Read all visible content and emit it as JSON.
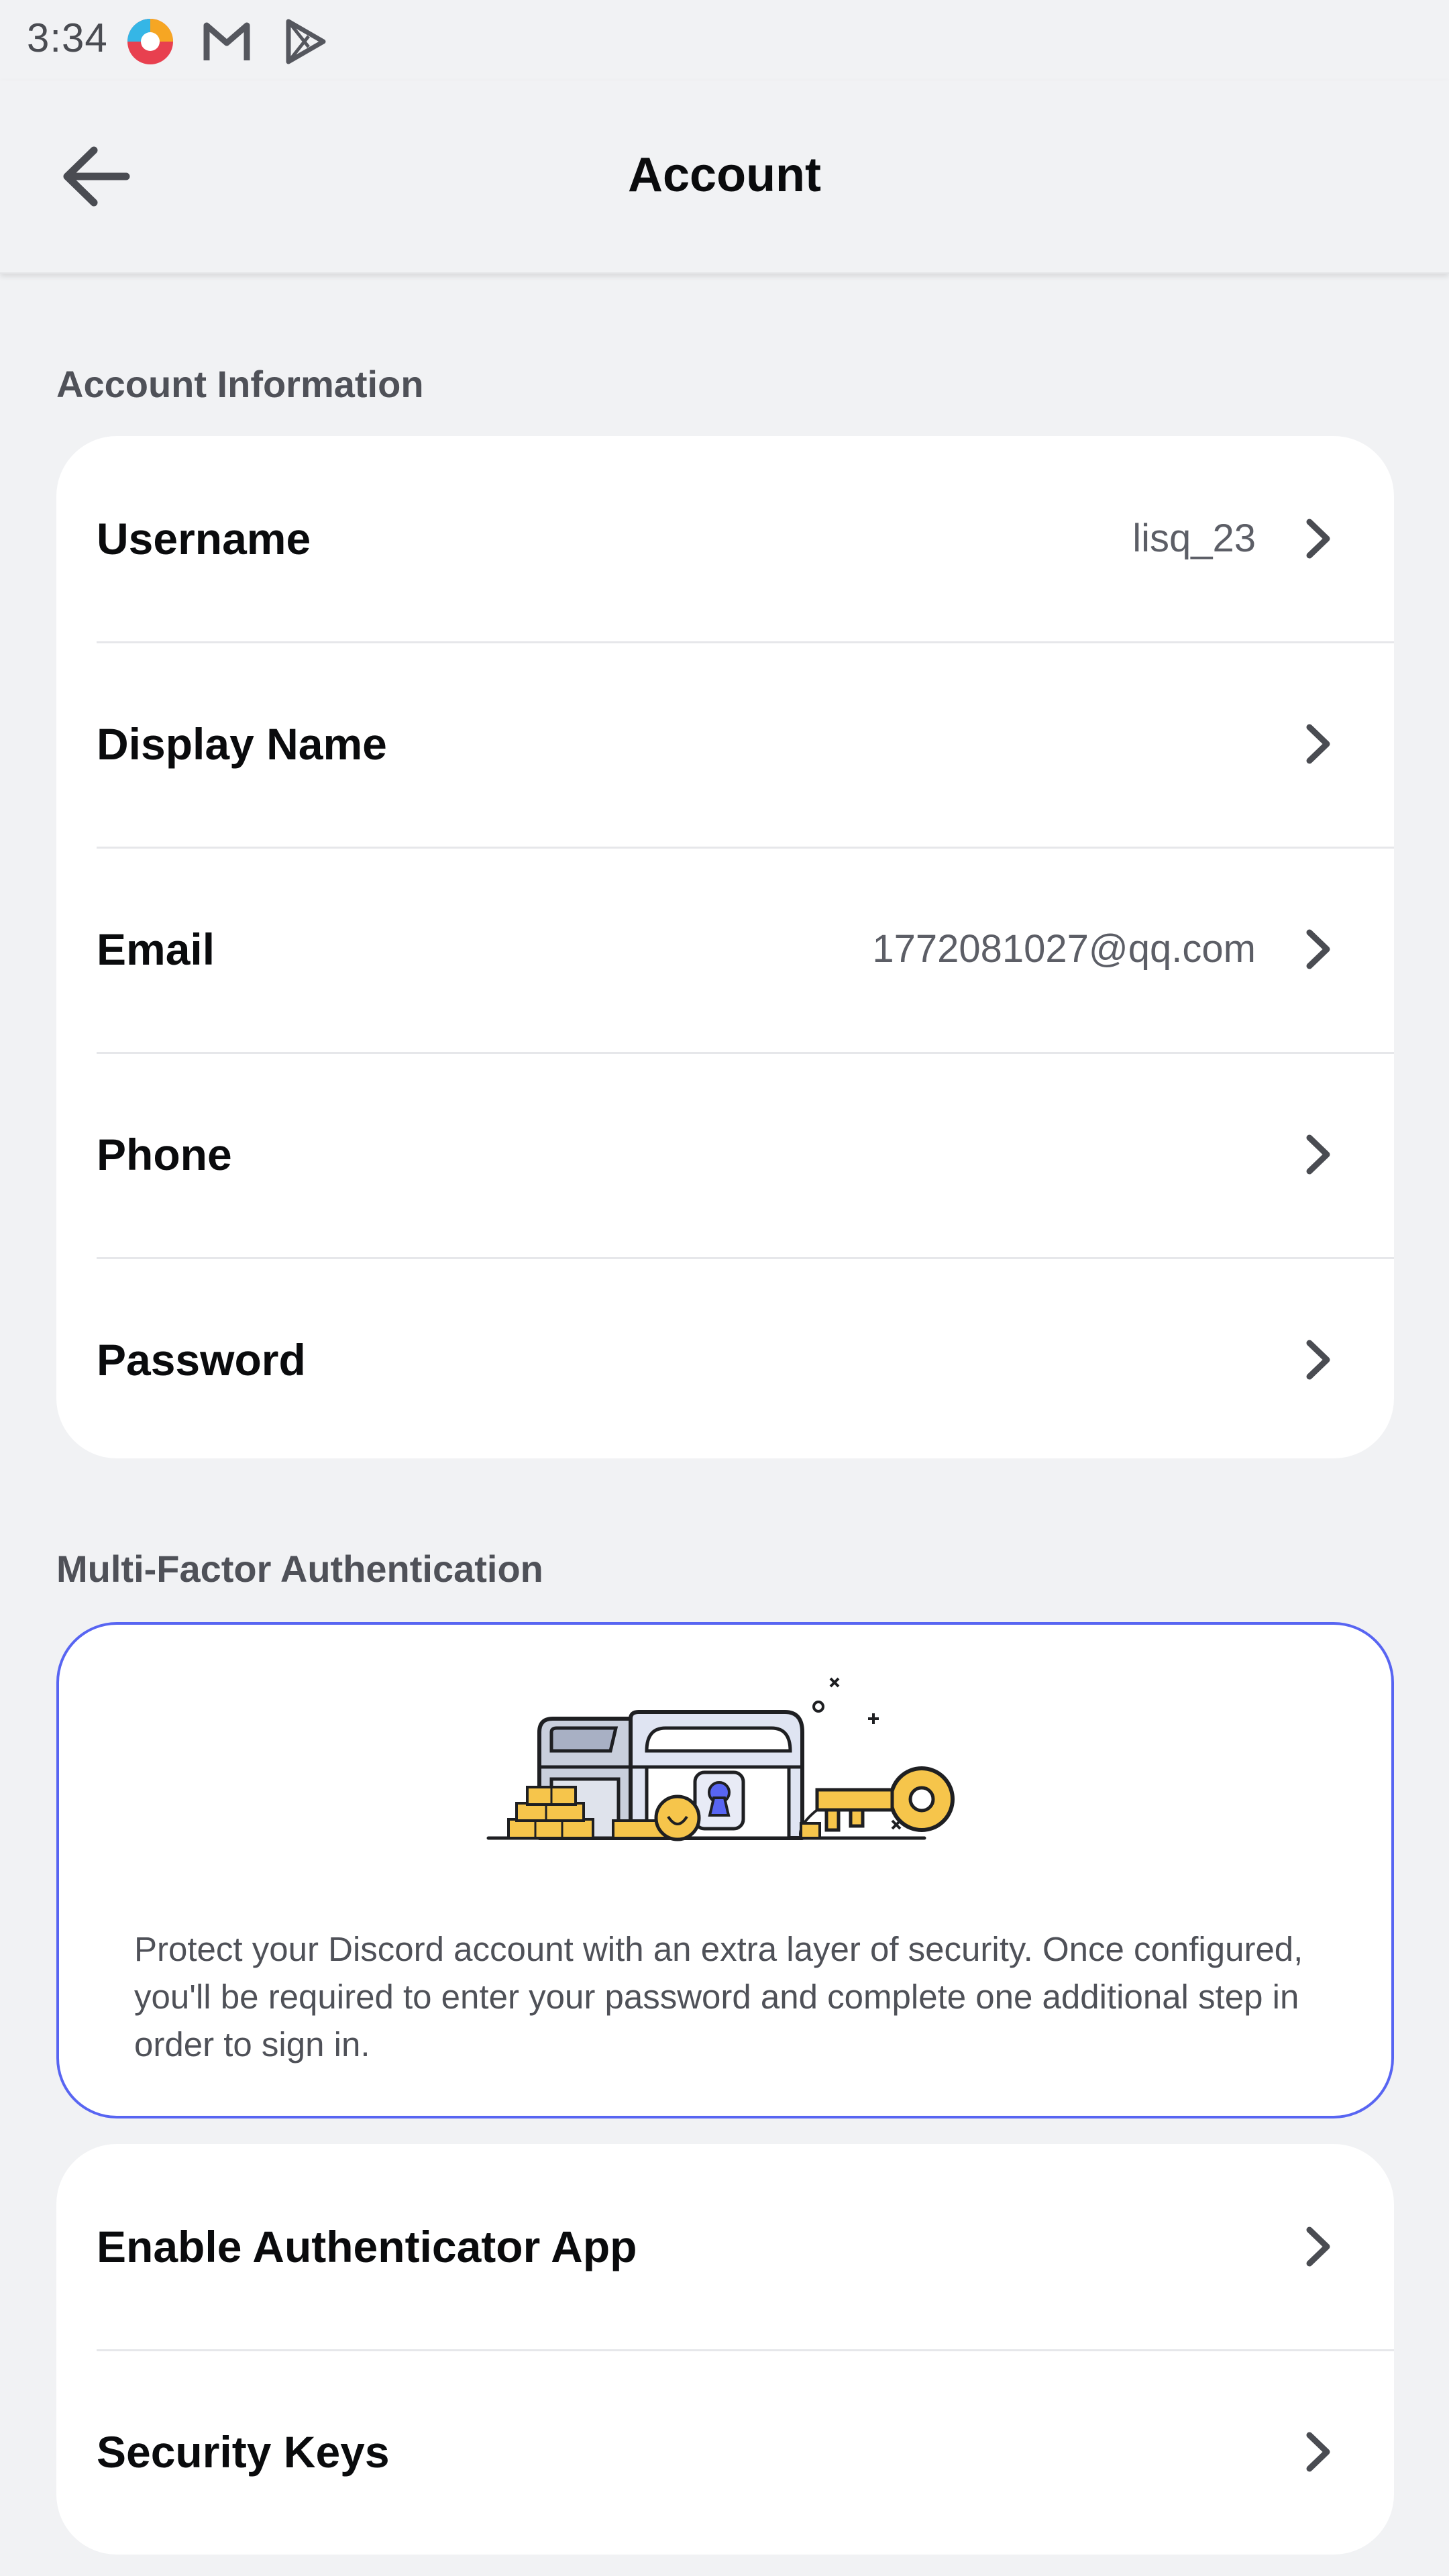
{
  "status_bar": {
    "time": "3:34",
    "icons": [
      "colorful-app-icon",
      "gmail-icon",
      "play-store-icon"
    ]
  },
  "header": {
    "title": "Account",
    "back_icon": "arrow-left-icon"
  },
  "account_info": {
    "section_label": "Account Information",
    "rows": [
      {
        "label": "Username",
        "value": "lisq_23"
      },
      {
        "label": "Display Name",
        "value": ""
      },
      {
        "label": "Email",
        "value": "1772081027@qq.com"
      },
      {
        "label": "Phone",
        "value": ""
      },
      {
        "label": "Password",
        "value": ""
      }
    ]
  },
  "mfa": {
    "section_label": "Multi-Factor Authentication",
    "illustration": "treasure-chest-key-illustration",
    "description": "Protect your Discord account with an extra layer of security. Once configured, you'll be required to enter your password and complete one additional step in order to sign in.",
    "rows": [
      {
        "label": "Enable Authenticator App"
      },
      {
        "label": "Security Keys"
      }
    ]
  },
  "colors": {
    "background": "#f1f2f4",
    "card": "#ffffff",
    "accent": "#5865f2",
    "text_primary": "#0a0b0d",
    "text_secondary": "#5c5e66",
    "illustration_gold": "#f6c54b"
  }
}
